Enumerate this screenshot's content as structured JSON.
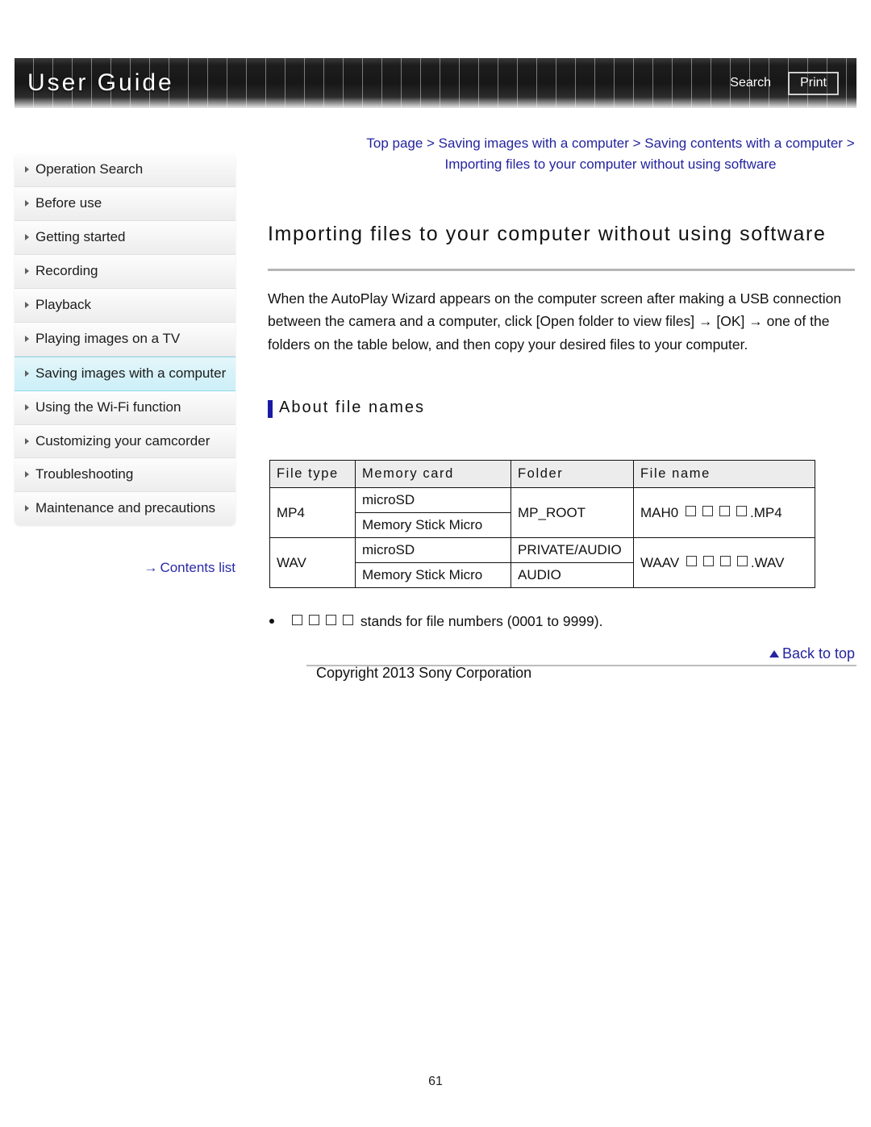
{
  "header": {
    "title": "User Guide",
    "search_label": "Search",
    "print_label": "Print"
  },
  "sidebar": {
    "items": [
      {
        "label": "Operation Search",
        "active": false
      },
      {
        "label": "Before use",
        "active": false
      },
      {
        "label": "Getting started",
        "active": false
      },
      {
        "label": "Recording",
        "active": false
      },
      {
        "label": "Playback",
        "active": false
      },
      {
        "label": "Playing images on a TV",
        "active": false
      },
      {
        "label": "Saving images with a computer",
        "active": true
      },
      {
        "label": "Using the Wi-Fi function",
        "active": false
      },
      {
        "label": "Customizing your camcorder",
        "active": false
      },
      {
        "label": "Troubleshooting",
        "active": false
      },
      {
        "label": "Maintenance and precautions",
        "active": false
      }
    ],
    "contents_link": "Contents list",
    "contents_arrow": "→"
  },
  "main": {
    "breadcrumb": "Top page > Saving images with a computer > Saving contents with a computer > Importing files to your computer without using software",
    "page_title": "Importing files to your computer without using software",
    "body_text": "When the AutoPlay Wizard appears on the computer screen after making a USB connection between the camera and a computer, click [Open folder to view files] → [OK] → one of the folders on the table below, and then copy your desired files to your computer.",
    "section_heading": "About file names",
    "note_text": "stands for file numbers (0001 to 9999).",
    "note_box_count": 4,
    "back_to_top": "Back to top",
    "copyright": "Copyright 2013 Sony Corporation",
    "page_number": "61"
  },
  "table": {
    "headers": [
      "File type",
      "Memory card",
      "Folder",
      "File name"
    ],
    "rows": [
      {
        "file_type": "MP4",
        "cards": [
          "microSD",
          "Memory Stick Micro"
        ],
        "folders": [
          "MP_ROOT"
        ],
        "folder_spans_cards": true,
        "file_name_prefix": "MAH0",
        "file_name_suffix": ".MP4",
        "file_name_box_count": 4
      },
      {
        "file_type": "WAV",
        "cards": [
          "microSD",
          "Memory Stick Micro"
        ],
        "folders": [
          "PRIVATE/AUDIO",
          "AUDIO"
        ],
        "folder_spans_cards": false,
        "file_name_prefix": "WAAV",
        "file_name_suffix": ".WAV",
        "file_name_box_count": 4
      }
    ]
  }
}
